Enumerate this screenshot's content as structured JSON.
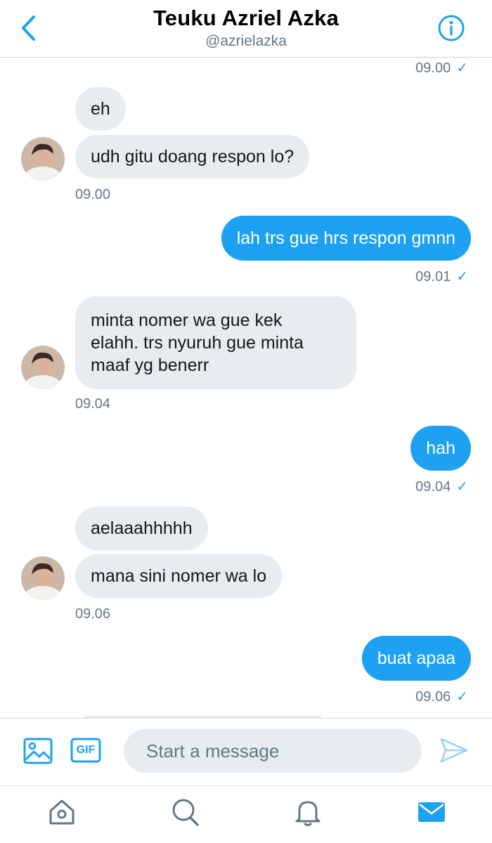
{
  "header": {
    "title": "Teuku Azriel Azka",
    "handle": "@azrielazka",
    "icons": {
      "back": "chevron-left-icon",
      "info": "info-icon"
    }
  },
  "messages": {
    "ts_top": "09.00",
    "in1": {
      "bubbles": [
        "eh",
        "udh gitu doang respon lo?"
      ],
      "time": "09.00"
    },
    "out1": {
      "text": "lah trs gue hrs respon gmnn",
      "time": "09.01"
    },
    "in2": {
      "lines": [
        "minta nomer wa gue kek",
        "elahh. trs nyuruh gue minta",
        "maaf yg benerr"
      ],
      "time": "09.04"
    },
    "out2": {
      "text": "hah",
      "time": "09.04"
    },
    "in3": {
      "bubbles": [
        "aelaaahhhhh",
        "mana sini nomer wa lo"
      ],
      "time": "09.06"
    },
    "out3": {
      "text": "buat apaa",
      "time": "09.06"
    },
    "read_mark": "✓"
  },
  "composer": {
    "placeholder": "Start a message",
    "gif_label": "GIF",
    "icons": {
      "media": "image-icon",
      "gif": "gif-icon",
      "send": "send-icon"
    }
  },
  "tabbar": {
    "icons": [
      "home-icon",
      "search-icon",
      "notifications-icon",
      "messages-icon"
    ],
    "active": "messages"
  },
  "colors": {
    "accent": "#1da1f2",
    "incoming_bubble": "#e6ecf0",
    "muted_text": "#657786",
    "text": "#14171a"
  }
}
